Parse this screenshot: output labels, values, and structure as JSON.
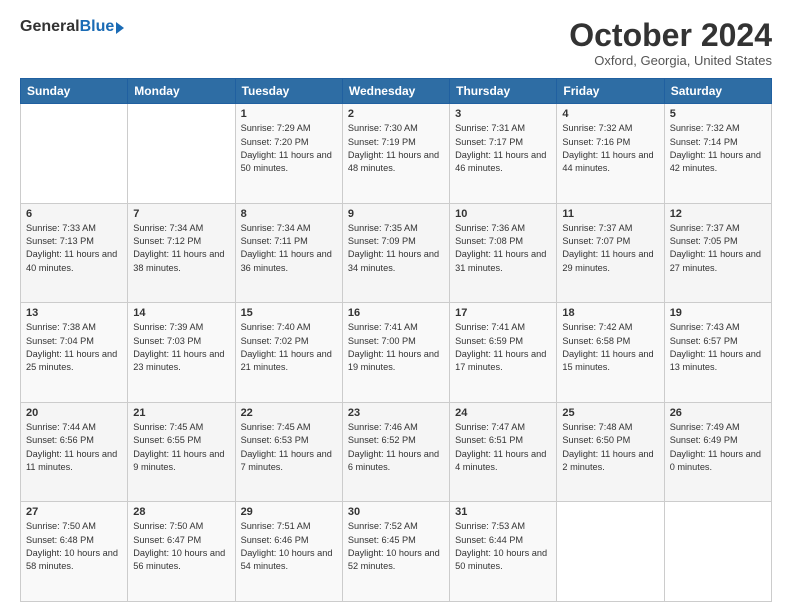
{
  "header": {
    "logo_general": "General",
    "logo_blue": "Blue",
    "month_title": "October 2024",
    "location": "Oxford, Georgia, United States"
  },
  "days_header": [
    "Sunday",
    "Monday",
    "Tuesday",
    "Wednesday",
    "Thursday",
    "Friday",
    "Saturday"
  ],
  "weeks": [
    {
      "days": [
        {
          "num": "",
          "info": ""
        },
        {
          "num": "",
          "info": ""
        },
        {
          "num": "1",
          "info": "Sunrise: 7:29 AM\nSunset: 7:20 PM\nDaylight: 11 hours and 50 minutes."
        },
        {
          "num": "2",
          "info": "Sunrise: 7:30 AM\nSunset: 7:19 PM\nDaylight: 11 hours and 48 minutes."
        },
        {
          "num": "3",
          "info": "Sunrise: 7:31 AM\nSunset: 7:17 PM\nDaylight: 11 hours and 46 minutes."
        },
        {
          "num": "4",
          "info": "Sunrise: 7:32 AM\nSunset: 7:16 PM\nDaylight: 11 hours and 44 minutes."
        },
        {
          "num": "5",
          "info": "Sunrise: 7:32 AM\nSunset: 7:14 PM\nDaylight: 11 hours and 42 minutes."
        }
      ]
    },
    {
      "days": [
        {
          "num": "6",
          "info": "Sunrise: 7:33 AM\nSunset: 7:13 PM\nDaylight: 11 hours and 40 minutes."
        },
        {
          "num": "7",
          "info": "Sunrise: 7:34 AM\nSunset: 7:12 PM\nDaylight: 11 hours and 38 minutes."
        },
        {
          "num": "8",
          "info": "Sunrise: 7:34 AM\nSunset: 7:11 PM\nDaylight: 11 hours and 36 minutes."
        },
        {
          "num": "9",
          "info": "Sunrise: 7:35 AM\nSunset: 7:09 PM\nDaylight: 11 hours and 34 minutes."
        },
        {
          "num": "10",
          "info": "Sunrise: 7:36 AM\nSunset: 7:08 PM\nDaylight: 11 hours and 31 minutes."
        },
        {
          "num": "11",
          "info": "Sunrise: 7:37 AM\nSunset: 7:07 PM\nDaylight: 11 hours and 29 minutes."
        },
        {
          "num": "12",
          "info": "Sunrise: 7:37 AM\nSunset: 7:05 PM\nDaylight: 11 hours and 27 minutes."
        }
      ]
    },
    {
      "days": [
        {
          "num": "13",
          "info": "Sunrise: 7:38 AM\nSunset: 7:04 PM\nDaylight: 11 hours and 25 minutes."
        },
        {
          "num": "14",
          "info": "Sunrise: 7:39 AM\nSunset: 7:03 PM\nDaylight: 11 hours and 23 minutes."
        },
        {
          "num": "15",
          "info": "Sunrise: 7:40 AM\nSunset: 7:02 PM\nDaylight: 11 hours and 21 minutes."
        },
        {
          "num": "16",
          "info": "Sunrise: 7:41 AM\nSunset: 7:00 PM\nDaylight: 11 hours and 19 minutes."
        },
        {
          "num": "17",
          "info": "Sunrise: 7:41 AM\nSunset: 6:59 PM\nDaylight: 11 hours and 17 minutes."
        },
        {
          "num": "18",
          "info": "Sunrise: 7:42 AM\nSunset: 6:58 PM\nDaylight: 11 hours and 15 minutes."
        },
        {
          "num": "19",
          "info": "Sunrise: 7:43 AM\nSunset: 6:57 PM\nDaylight: 11 hours and 13 minutes."
        }
      ]
    },
    {
      "days": [
        {
          "num": "20",
          "info": "Sunrise: 7:44 AM\nSunset: 6:56 PM\nDaylight: 11 hours and 11 minutes."
        },
        {
          "num": "21",
          "info": "Sunrise: 7:45 AM\nSunset: 6:55 PM\nDaylight: 11 hours and 9 minutes."
        },
        {
          "num": "22",
          "info": "Sunrise: 7:45 AM\nSunset: 6:53 PM\nDaylight: 11 hours and 7 minutes."
        },
        {
          "num": "23",
          "info": "Sunrise: 7:46 AM\nSunset: 6:52 PM\nDaylight: 11 hours and 6 minutes."
        },
        {
          "num": "24",
          "info": "Sunrise: 7:47 AM\nSunset: 6:51 PM\nDaylight: 11 hours and 4 minutes."
        },
        {
          "num": "25",
          "info": "Sunrise: 7:48 AM\nSunset: 6:50 PM\nDaylight: 11 hours and 2 minutes."
        },
        {
          "num": "26",
          "info": "Sunrise: 7:49 AM\nSunset: 6:49 PM\nDaylight: 11 hours and 0 minutes."
        }
      ]
    },
    {
      "days": [
        {
          "num": "27",
          "info": "Sunrise: 7:50 AM\nSunset: 6:48 PM\nDaylight: 10 hours and 58 minutes."
        },
        {
          "num": "28",
          "info": "Sunrise: 7:50 AM\nSunset: 6:47 PM\nDaylight: 10 hours and 56 minutes."
        },
        {
          "num": "29",
          "info": "Sunrise: 7:51 AM\nSunset: 6:46 PM\nDaylight: 10 hours and 54 minutes."
        },
        {
          "num": "30",
          "info": "Sunrise: 7:52 AM\nSunset: 6:45 PM\nDaylight: 10 hours and 52 minutes."
        },
        {
          "num": "31",
          "info": "Sunrise: 7:53 AM\nSunset: 6:44 PM\nDaylight: 10 hours and 50 minutes."
        },
        {
          "num": "",
          "info": ""
        },
        {
          "num": "",
          "info": ""
        }
      ]
    }
  ]
}
